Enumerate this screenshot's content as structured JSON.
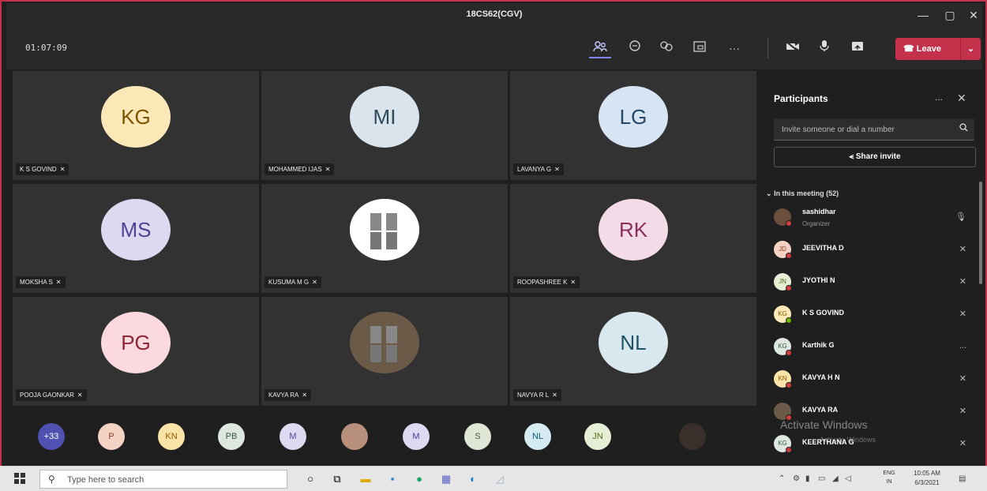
{
  "window": {
    "title": "18CS62(CGV)"
  },
  "toolbar": {
    "timer": "01:07:09",
    "icons": [
      "participants-icon",
      "chat-icon",
      "reactions-icon",
      "share-tray-icon",
      "more-icon",
      "camera-off-icon",
      "mic-icon",
      "share-screen-icon"
    ],
    "leave_label": "Leave",
    "leave_color": "#c4314b"
  },
  "tiles": [
    {
      "initials": "KG",
      "name": "K S GOVIND",
      "color": "#fde9b7"
    },
    {
      "initials": "MI",
      "name": "MOHAMMED IJAS",
      "color": "#d9e4ec"
    },
    {
      "initials": "LG",
      "name": "LAVANYA G",
      "color": "#d6e4f3"
    },
    {
      "initials": "MS",
      "name": "MOKSHA S",
      "color": "#dcd9f1"
    },
    {
      "initials": "",
      "name": "KUSUMA M G",
      "color": "#ffffff"
    },
    {
      "initials": "RK",
      "name": "ROOPASHREE K",
      "color": "#f3dbe7"
    },
    {
      "initials": "PG",
      "name": "POOJA GAONKAR",
      "color": "#fbd9df"
    },
    {
      "initials": "",
      "name": "KAVYA RA",
      "color": "#6b5a48"
    },
    {
      "initials": "NL",
      "name": "NAVYA R L",
      "color": "#d9e8ee"
    }
  ],
  "strip": [
    {
      "label": "+33",
      "color": "#4f52b2",
      "text_color": "#ffffff"
    },
    {
      "label": "P",
      "color": "#f4d3c4",
      "text_color": "#8b3a1f"
    },
    {
      "label": "KN",
      "color": "#fce3a8",
      "text_color": "#8a5a00"
    },
    {
      "label": "PB",
      "color": "#dde7df",
      "text_color": "#335b3b"
    },
    {
      "label": "M",
      "color": "#dcd9f1",
      "text_color": "#4b4393"
    },
    {
      "label": "",
      "color": "#b88f7a",
      "text_color": "#ffffff"
    },
    {
      "label": "M",
      "color": "#dcd9f1",
      "text_color": "#4b4393"
    },
    {
      "label": "S",
      "color": "#dfe6d6",
      "text_color": "#4a5a2e"
    },
    {
      "label": "NL",
      "color": "#d5ebf2",
      "text_color": "#0f5a77"
    },
    {
      "label": "JN",
      "color": "#e6efd6",
      "text_color": "#566b16"
    },
    {
      "label": "",
      "color": "#3a2f2a",
      "text_color": "#ffffff"
    }
  ],
  "panel": {
    "title": "Participants",
    "more": "...",
    "close": "✕",
    "invite_placeholder": "Invite someone or dial a number",
    "share_label": "Share invite",
    "section": "In this meeting (52)",
    "participants": [
      {
        "initials": "",
        "name": "sashidhar",
        "role": "Organizer",
        "color": "#6b4f3c",
        "status": "#cf3e3e",
        "mic": "🎙"
      },
      {
        "initials": "JD",
        "name": "JEEVITHA D",
        "role": "",
        "color": "#f4d3c4",
        "status": "#cf3e3e",
        "mic": "✕"
      },
      {
        "initials": "JN",
        "name": "JYOTHI N",
        "role": "",
        "color": "#e6efd6",
        "status": "#cf3e3e",
        "mic": "✕"
      },
      {
        "initials": "KG",
        "name": "K S GOVIND",
        "role": "",
        "color": "#fde9b7",
        "status": "#6bb700",
        "mic": "✕"
      },
      {
        "initials": "KG",
        "name": "Karthik G",
        "role": "",
        "color": "#dde7df",
        "status": "#cf3e3e",
        "mic": "..."
      },
      {
        "initials": "KN",
        "name": "KAVYA H N",
        "role": "",
        "color": "#fce3a8",
        "status": "#cf3e3e",
        "mic": "✕"
      },
      {
        "initials": "",
        "name": "KAVYA RA",
        "role": "",
        "color": "#6b5a48",
        "status": "#cf3e3e",
        "mic": "✕"
      },
      {
        "initials": "KG",
        "name": "KEERTHANA G",
        "role": "",
        "color": "#dde7df",
        "status": "#cf3e3e",
        "mic": "✕"
      }
    ]
  },
  "watermark": {
    "title": "Activate Windows",
    "sub": "Activate Windows"
  },
  "taskbar": {
    "search_placeholder": "Type here to search",
    "lang_top": "ENG",
    "lang_bottom": "IN",
    "time": "10:05 AM",
    "date": "6/3/2021"
  }
}
